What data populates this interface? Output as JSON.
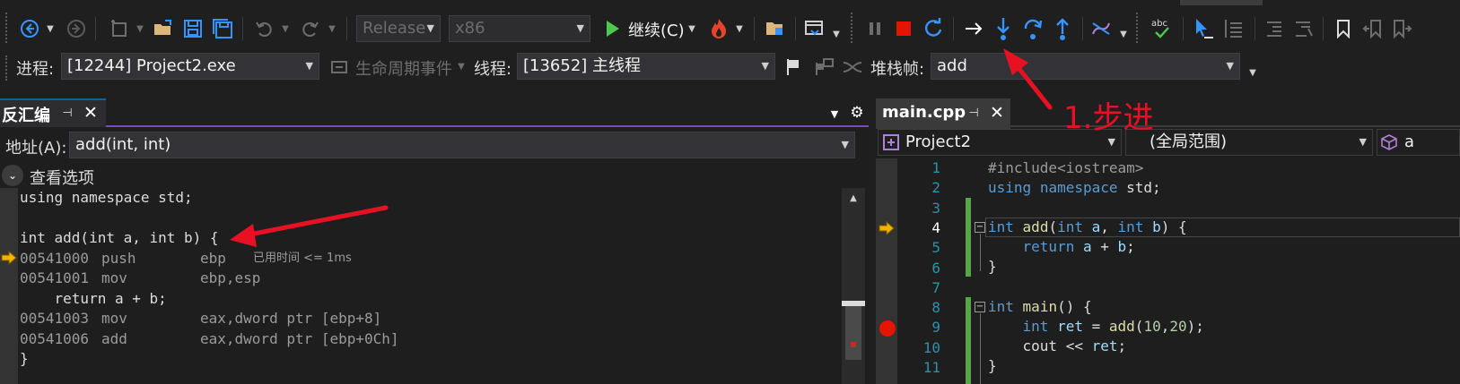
{
  "toolbar1": {
    "config": "Release",
    "platform": "x86",
    "continue_label": "继续(C)",
    "icons": [
      "back-icon",
      "forward-icon",
      "new-project-icon",
      "open-folder-icon",
      "save-icon",
      "save-all-icon",
      "undo-icon",
      "redo-icon",
      "play-icon",
      "hot-reload-icon",
      "folder-icon",
      "window-icon",
      "pause-icon",
      "stop-icon",
      "restart-icon",
      "show-next-statement-icon",
      "step-into-icon",
      "step-over-icon",
      "step-out-icon",
      "hex-icon",
      "spell-check-icon",
      "pointer-icon",
      "format-icon",
      "bookmark-icon"
    ]
  },
  "toolbar2": {
    "process_label": "进程:",
    "process_value": "[12244] Project2.exe",
    "lifecycle_label": "生命周期事件",
    "thread_label": "线程:",
    "thread_value": "[13652] 主线程",
    "stackframe_label": "堆栈帧:",
    "stackframe_value": "add"
  },
  "annotation": {
    "text": "1.步进",
    "color": "#e81123"
  },
  "disasm": {
    "tab_title": "反汇编",
    "address_label": "地址(A):",
    "address_value": "add(int, int)",
    "view_options": "查看选项",
    "lines": [
      {
        "type": "src",
        "text": "using namespace std;"
      },
      {
        "type": "blank",
        "text": ""
      },
      {
        "type": "src",
        "text": "int add(int a, int b) {"
      },
      {
        "type": "asm",
        "addr": "00541000",
        "op": "push",
        "args": "ebp",
        "note": "已用时间 <= 1ms"
      },
      {
        "type": "asm",
        "addr": "00541001",
        "op": "mov",
        "args": "ebp,esp",
        "note": ""
      },
      {
        "type": "src",
        "text": "    return a + b;"
      },
      {
        "type": "asm",
        "addr": "00541003",
        "op": "mov",
        "args": "eax,dword ptr [ebp+8]",
        "note": ""
      },
      {
        "type": "asm",
        "addr": "00541006",
        "op": "add",
        "args": "eax,dword ptr [ebp+0Ch]",
        "note": ""
      },
      {
        "type": "src",
        "text": "}"
      }
    ]
  },
  "editor": {
    "tab_title": "main.cpp",
    "project_combo": "Project2",
    "scope_combo": "(全局范围)",
    "member_combo_initial": "a",
    "line_numbers": [
      "1",
      "2",
      "3",
      "4",
      "5",
      "6",
      "7",
      "8",
      "9",
      "10",
      "11"
    ],
    "current_line": "4",
    "breakpoint_line": "9"
  },
  "colors": {
    "accent": "#0e639c",
    "change_bar": "#57a64a",
    "breakpoint": "#e51400",
    "current_arrow": "#f0b400"
  }
}
